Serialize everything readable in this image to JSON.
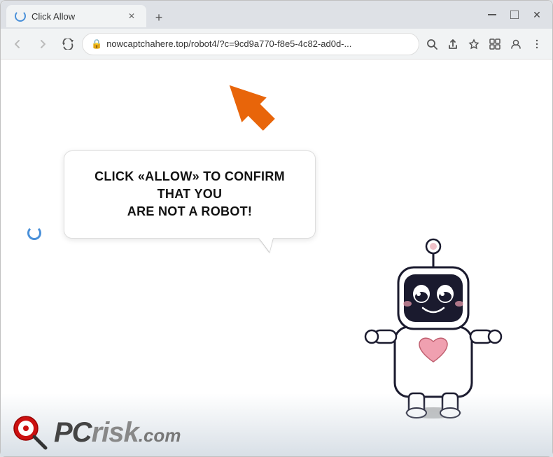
{
  "browser": {
    "tab": {
      "title": "Click Allow",
      "favicon_state": "loading"
    },
    "address_bar": {
      "url": "nowcaptchahere.top/robot4/?c=9cd9a770-f8e5-4c82-ad0d-...",
      "protocol": "https"
    },
    "new_tab_label": "+",
    "window_controls": {
      "minimize": "—",
      "maximize": "□",
      "close": "✕"
    },
    "nav": {
      "back": "←",
      "forward": "→",
      "refresh": "✕"
    }
  },
  "page": {
    "bubble_text_line1": "CLICK «ALLOW» TO CONFIRM THAT YOU",
    "bubble_text_line2": "ARE NOT A ROBOT!",
    "arrow_color": "#e8650a"
  },
  "watermark": {
    "logo_text_pc": "PC",
    "logo_text_risk": "risk",
    "logo_text_dotcom": ".com"
  }
}
